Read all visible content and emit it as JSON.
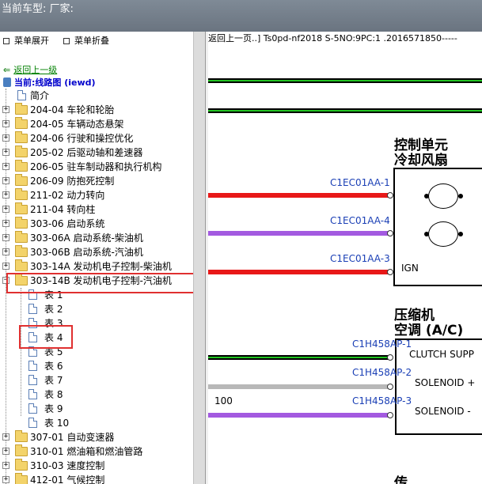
{
  "top_title": "当前车型:  厂家:",
  "menu": {
    "expand": "菜单展开",
    "collapse": "菜单折叠"
  },
  "back_link": "返回上一级",
  "current": "当前:线路图 (iewd)",
  "tree": {
    "intro": "简介",
    "folders": [
      "204-04 车轮和轮胎",
      "204-05 车辆动态悬架",
      "204-06 行驶和操控优化",
      "205-02 后驱动轴和差速器",
      "206-05 驻车制动器和执行机构",
      "206-09 防抱死控制",
      "211-02 动力转向",
      "211-04 转向柱",
      "303-06 启动系统",
      "303-06A 启动系统-柴油机",
      "303-06B 启动系统-汽油机",
      "303-14A 发动机电子控制-柴油机",
      "303-14B 发动机电子控制-汽油机"
    ],
    "sub_items": [
      "表 1",
      "表 2",
      "表 3",
      "表 4",
      "表 5",
      "表 6",
      "表 7",
      "表 8",
      "表 9",
      "表 10"
    ],
    "folders_after": [
      "307-01 自动变速器",
      "310-01 燃油箱和燃油管路",
      "310-03 速度控制",
      "412-01 气候控制"
    ]
  },
  "diagram": {
    "breadcrumb": "返回上一页..] Ts0pd-nf2018 S-5NO:9PC:1 .2016571850-----",
    "fan_title": [
      "控制单元",
      "冷却风扇"
    ],
    "ac_title": [
      "压缩机",
      "空调 (A/C)"
    ],
    "fan_pins": [
      "C1EC01AA-1",
      "C1EC01AA-4",
      "C1EC01AA-3"
    ],
    "ign": "IGN",
    "ac_pins": [
      "C1H458AP-1",
      "C1H458AP-2",
      "C1H458AP-3"
    ],
    "ac_labels": [
      "CLUTCH SUPP",
      "SOLENOID +",
      "SOLENOID -"
    ],
    "wire_number": "100",
    "bottom_partial": "传"
  },
  "colors": {
    "red": "#e81818",
    "purple": "#a35ae0",
    "gray": "#b8b8b8",
    "green": "#22c422",
    "highlight": "#e03030"
  }
}
